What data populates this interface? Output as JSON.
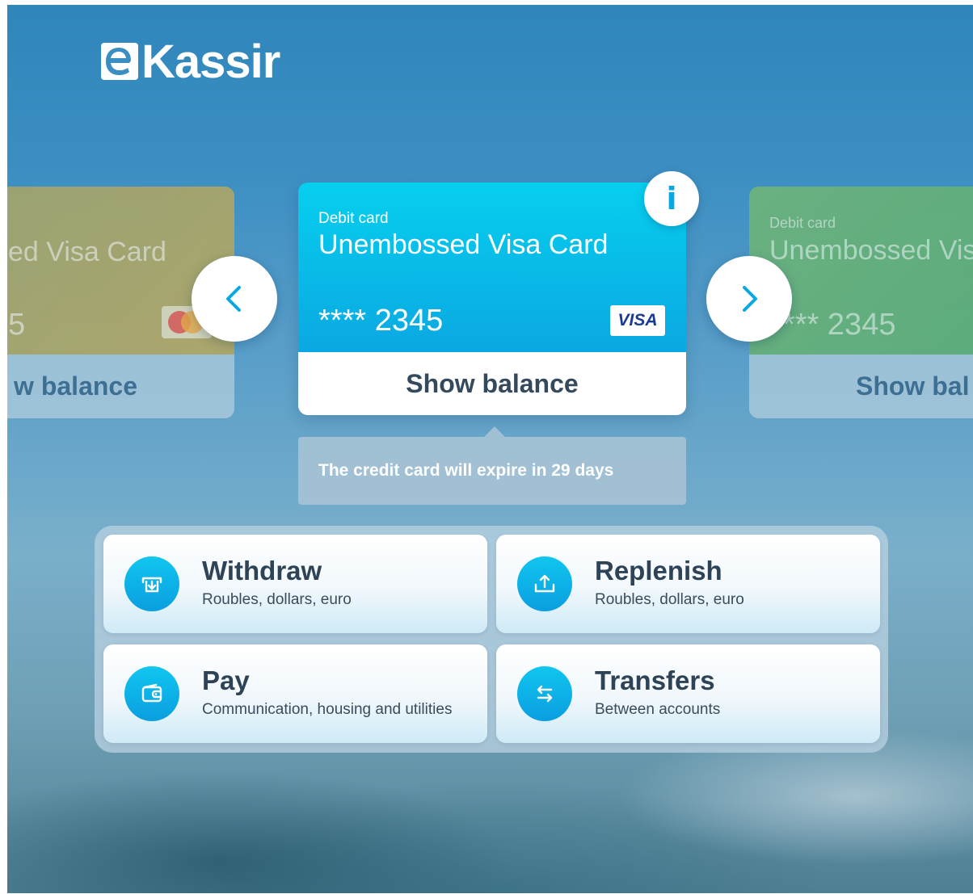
{
  "brand": {
    "logo_text": "eKassir"
  },
  "cards": {
    "left": {
      "name": "ed Visa Card",
      "number": "5",
      "balance_label": "w balance",
      "network_icon": "mastercard-logo"
    },
    "current": {
      "type": "Debit card",
      "name": "Unembossed Visa Card",
      "number": "**** 2345",
      "network_logo": "VISA",
      "balance_label": "Show balance",
      "info_icon": "i"
    },
    "right": {
      "type": "Debit card",
      "name": "Unembossed Vis",
      "number": "*** 2345",
      "balance_label": "Show bal"
    }
  },
  "notice": {
    "text": "The credit card will expire in 29 days"
  },
  "actions": [
    {
      "title": "Withdraw",
      "subtitle": "Roubles, dollars, euro",
      "icon": "withdraw-icon"
    },
    {
      "title": "Replenish",
      "subtitle": "Roubles, dollars, euro",
      "icon": "replenish-icon"
    },
    {
      "title": "Pay",
      "subtitle": "Communication, housing and utilities",
      "icon": "wallet-icon"
    },
    {
      "title": "Transfers",
      "subtitle": "Between accounts",
      "icon": "transfer-icon"
    }
  ],
  "colors": {
    "accent": "#0aa8e2",
    "card_cyan": "#07cfee",
    "card_left": "#a3a46c",
    "card_right": "#5aad73",
    "text_dark": "#2e4356"
  }
}
